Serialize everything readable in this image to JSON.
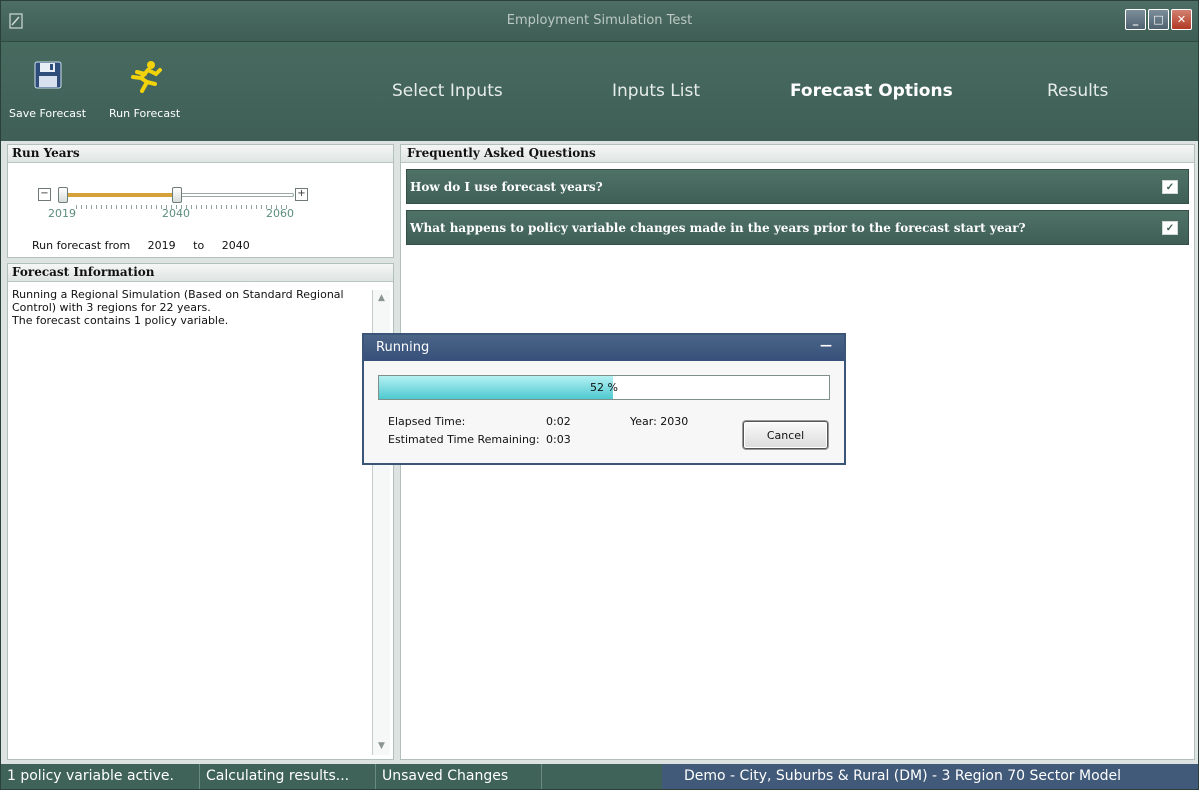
{
  "window": {
    "title": "Employment Simulation Test",
    "minimize": "_",
    "maximize": "□",
    "close": "✕"
  },
  "toolbar": {
    "save_label": "Save Forecast",
    "run_label": "Run Forecast"
  },
  "nav": {
    "tabs": [
      {
        "label": "Select Inputs"
      },
      {
        "label": "Inputs List"
      },
      {
        "label": "Forecast Options",
        "active": true
      },
      {
        "label": "Results"
      }
    ]
  },
  "run_years": {
    "title": "Run Years",
    "minus": "−",
    "plus": "+",
    "min_label": "2019",
    "mid_label": "2040",
    "max_label": "2060",
    "from_label": "Run forecast from",
    "from_value": "2019",
    "to_label": "to",
    "to_value": "2040"
  },
  "forecast_info": {
    "title": "Forecast Information",
    "line1": "Running a Regional Simulation (Based on Standard Regional Control) with 3 regions for 22 years.",
    "line2": "The forecast contains 1 policy variable."
  },
  "faq": {
    "title": "Frequently Asked Questions",
    "items": [
      {
        "question": "How do I use forecast years?"
      },
      {
        "question": "What happens to policy variable changes made in the years prior to the forecast start year?"
      }
    ]
  },
  "dialog": {
    "title": "Running",
    "progress_percent": 52,
    "progress_text": "52 %",
    "elapsed_label": "Elapsed Time:",
    "elapsed_value": "0:02",
    "year_label": "Year: 2030",
    "remaining_label": "Estimated Time Remaining:",
    "remaining_value": "0:03",
    "cancel_label": "Cancel"
  },
  "status": {
    "policy": "1 policy variable active.",
    "calc": "Calculating results...",
    "unsaved": "Unsaved Changes",
    "model": "Demo - City, Suburbs & Rural (DM) -  3 Region 70 Sector Model"
  },
  "colors": {
    "accent": "#3f6358",
    "dialog_title": "#3b5578",
    "progress": "#4ec9d0",
    "slider_fill": "#d5a13a"
  }
}
